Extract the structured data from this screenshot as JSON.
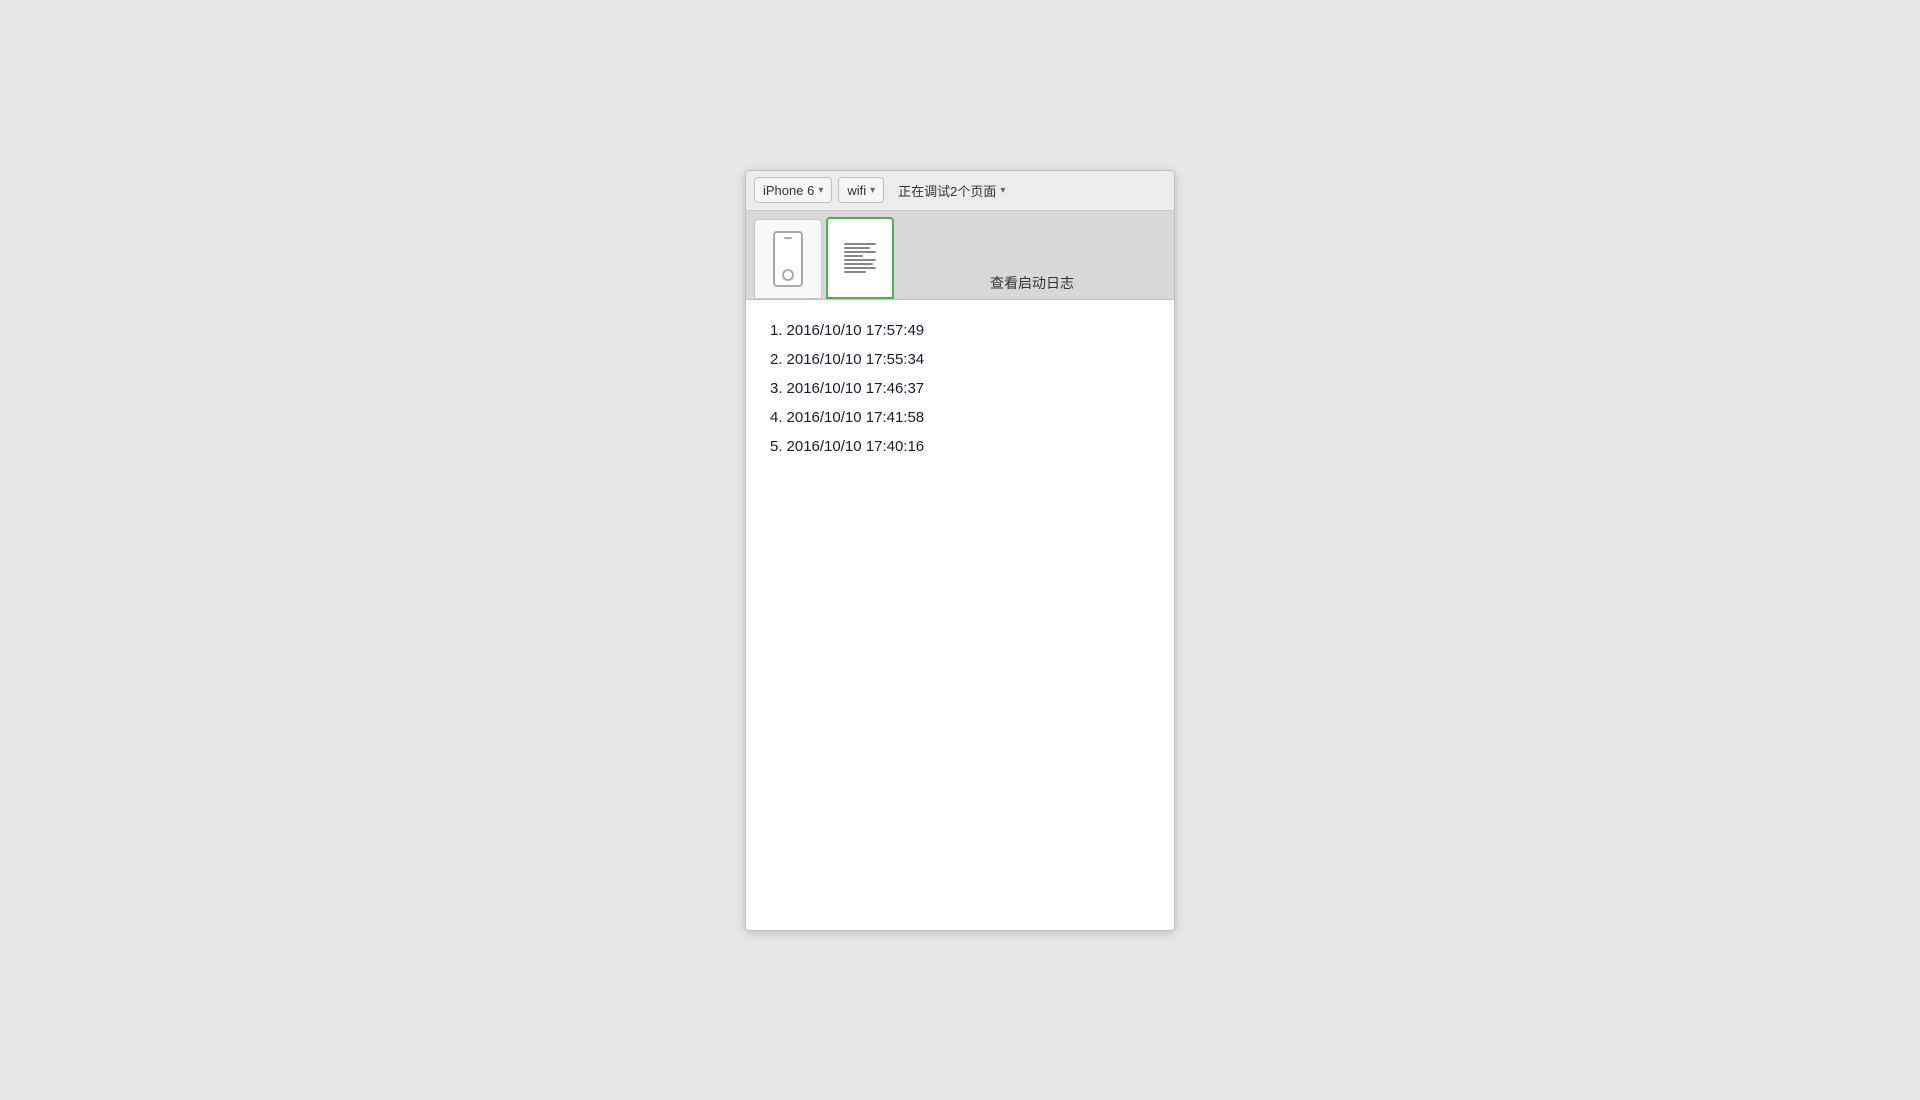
{
  "toolbar": {
    "device_label": "iPhone 6",
    "network_label": "wifi",
    "status_label": "正在调试2个页面",
    "device_chevron": "▾",
    "network_chevron": "▾",
    "status_chevron": "▾"
  },
  "tabs": [
    {
      "id": "tab1",
      "label": "tab-1",
      "active": false
    },
    {
      "id": "tab2",
      "label": "tab-2",
      "active": true
    }
  ],
  "page_title": "查看启动日志",
  "log_entries": [
    {
      "number": "1.",
      "timestamp": "2016/10/10 17:57:49"
    },
    {
      "number": "2.",
      "timestamp": "2016/10/10 17:55:34"
    },
    {
      "number": "3.",
      "timestamp": "2016/10/10 17:46:37"
    },
    {
      "number": "4.",
      "timestamp": "2016/10/10 17:41:58"
    },
    {
      "number": "5.",
      "timestamp": "2016/10/10 17:40:16"
    }
  ]
}
